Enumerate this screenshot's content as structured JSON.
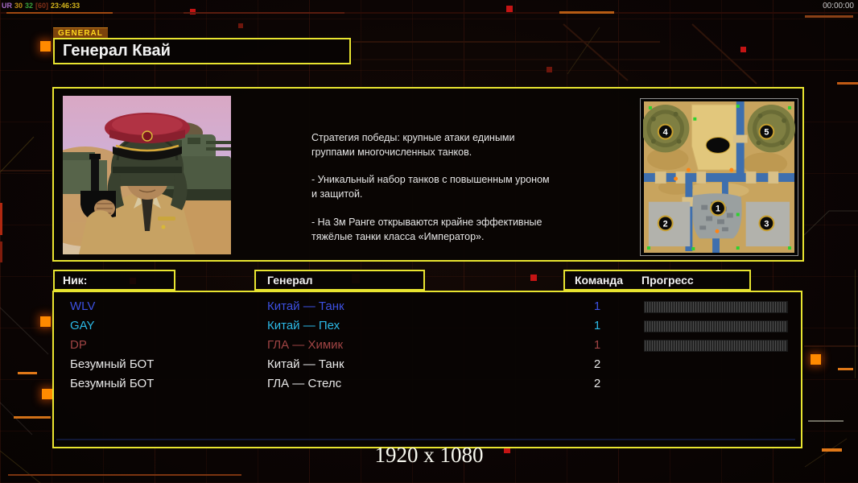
{
  "overlay": {
    "stats": {
      "tag": "UR",
      "v1": "30",
      "v2": "32",
      "v3": "[60]",
      "clock": "23:46:33"
    },
    "timer": "00:00:00"
  },
  "header": {
    "tab": "GENERAL",
    "title": "Генерал Квай"
  },
  "info": {
    "strategy": [
      "Стратегия победы: крупные атаки едиными\n группами многочисленных танков.",
      "- Уникальный набор танков с повышенным уроном\n и защитой.",
      "- На 3м Ранге открываются крайне эффективные\n тяжёлые танки класса «Император»."
    ]
  },
  "minimap": {
    "points": [
      {
        "label": "1"
      },
      {
        "label": "2"
      },
      {
        "label": "3"
      },
      {
        "label": "4"
      },
      {
        "label": "5"
      }
    ]
  },
  "table": {
    "headers": {
      "nick": "Ник:",
      "general": "Генерал",
      "team": "Команда",
      "progress": "Прогресс"
    },
    "rows": [
      {
        "nick": "WLV",
        "general": "Китай — Танк",
        "team": "1",
        "color": "#3c50e0",
        "progress": true
      },
      {
        "nick": "GAY",
        "general": "Китай — Пех",
        "team": "1",
        "color": "#2cb9e6",
        "progress": true
      },
      {
        "nick": "DP",
        "general": "ГЛА — Химик",
        "team": "1",
        "color": "#a04444",
        "progress": true
      },
      {
        "nick": "Безумный БОТ",
        "general": "Китай — Танк",
        "team": "2",
        "color": "#e8e8e8",
        "progress": false
      },
      {
        "nick": "Безумный БОТ",
        "general": "ГЛА — Стелс",
        "team": "2",
        "color": "#e8e8e8",
        "progress": false
      }
    ]
  },
  "footer": {
    "resolution": "1920 x 1080"
  },
  "colors": {
    "accent_yellow": "#e8e430",
    "accent_orange": "#ff8a00",
    "square_red": "#c41414",
    "background": "#0b0504",
    "minimap_border": "#8f8f8f"
  }
}
